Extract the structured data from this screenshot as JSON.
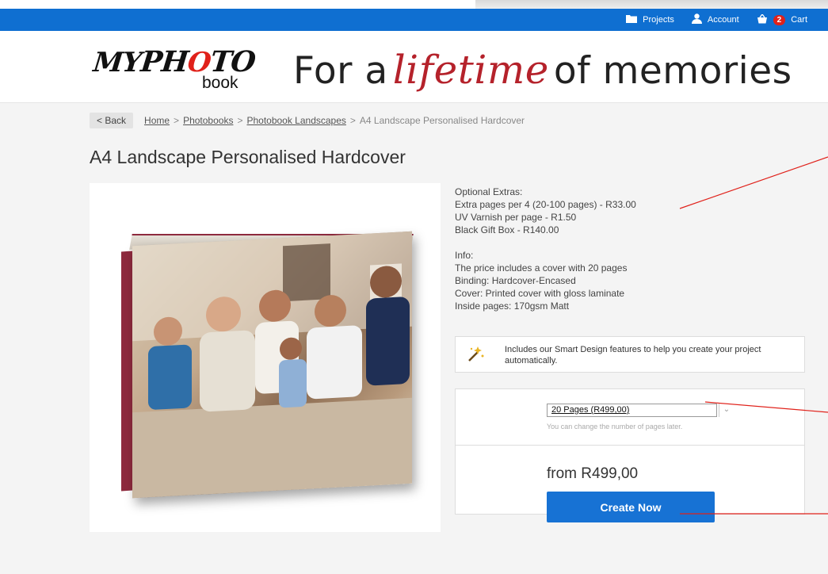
{
  "topnav": {
    "projects_label": "Projects",
    "account_label": "Account",
    "cart_count": "2",
    "cart_label": "Cart"
  },
  "logo": {
    "my_text": "MYPHOTO",
    "book_text": "book"
  },
  "tagline": {
    "part1": "For a",
    "script": "lifetime",
    "part2": "of memories"
  },
  "breadcrumb": {
    "back_label": "< Back",
    "items": [
      "Home",
      "Photobooks",
      "Photobook Landscapes",
      "A4 Landscape Personalised Hardcover"
    ],
    "separator": ">"
  },
  "product": {
    "title": "A4 Landscape Personalised Hardcover",
    "optional_heading": "Optional Extras:",
    "extras": [
      "Extra pages per 4 (20-100 pages) - R33.00",
      "UV Varnish per page - R1.50",
      "Black Gift Box - R140.00"
    ],
    "info_heading": "Info:",
    "info": [
      "The price includes a cover with 20 pages",
      "Binding: Hardcover-Encased",
      "Cover: Printed cover with gloss laminate",
      "Inside pages: 170gsm Matt"
    ]
  },
  "smart_design": {
    "text": "Includes our Smart Design features to help you create your project automatically."
  },
  "order": {
    "pages_selected": "20 Pages (R499,00)",
    "pages_hint": "You can change the number of pages later.",
    "price": "from R499,00",
    "cta_label": "Create Now"
  },
  "colors": {
    "topbar": "#0f6fd1",
    "cta": "#1772d4",
    "accent_red": "#b5222b",
    "annotation_red": "#e0211a"
  }
}
